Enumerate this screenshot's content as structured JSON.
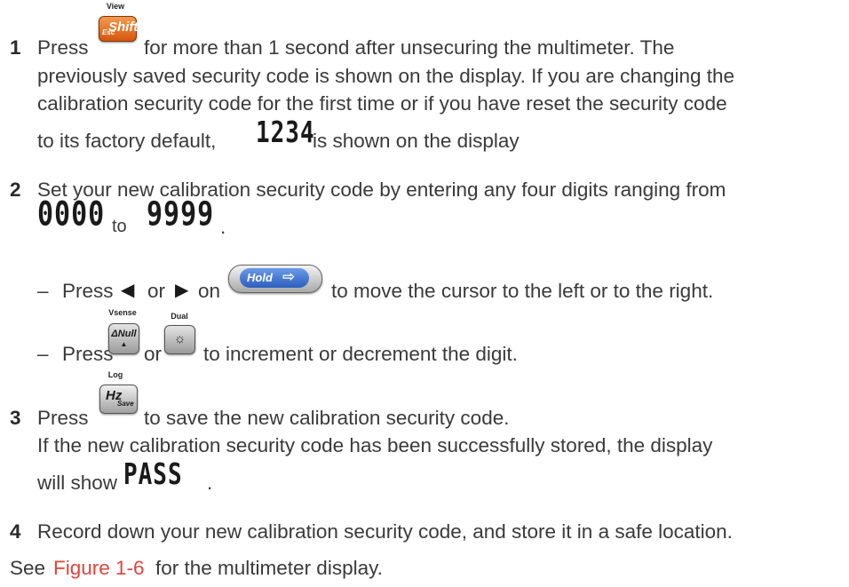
{
  "steps": [
    {
      "number": "1",
      "line1_a": "Press",
      "line1_b": "for more than 1 second after unsecuring the multimeter. The",
      "line2": "previously saved security code is shown on the display. If you are changing the",
      "line3": "calibration security code for the first time or if you have reset the security code",
      "line4_a": "to its factory default,",
      "line4_display": "1234",
      "line4_b": "is shown on the display"
    },
    {
      "number": "2",
      "line1": "Set your new calibration security code by entering any four digits ranging from",
      "range_from": "0000",
      "range_to_word": "to",
      "range_to": "9999",
      "range_end": "."
    },
    {
      "number": "3",
      "line1_a": "Press",
      "line1_b": "to save the new calibration security code.",
      "line2": "If the new calibration security code has been successfully stored, the display",
      "line3_a": "will show",
      "line3_display": "PASS",
      "line3_end": "."
    },
    {
      "number": "4",
      "line1": "Record down your new calibration security code, and store it in a safe location."
    }
  ],
  "sub_bullets": [
    {
      "dash": "–",
      "press": "Press",
      "left_arrow": "◀",
      "or": "or",
      "right_arrow": "▶",
      "on": "on",
      "text": "to move the cursor to the left or to the right."
    },
    {
      "dash": "–",
      "press": "Press",
      "or": "or",
      "text": "to increment or decrement the digit."
    }
  ],
  "keys": {
    "shift": {
      "top_label": "View",
      "main": "Shift",
      "sub": "Esc"
    },
    "hold": {
      "main": "Hold",
      "glyph": "⇨"
    },
    "null": {
      "top_label": "Vsense",
      "main": "ΔNull",
      "glyph": "▲"
    },
    "dual": {
      "top_label": "Dual",
      "glyph": "☼"
    },
    "hz": {
      "top_label": "Log",
      "main": "Hz",
      "sub": "Save"
    }
  },
  "footer": {
    "see": "See",
    "link": "Figure 1-6",
    "rest": "for the multimeter display."
  },
  "colors": {
    "link": "#e0443c",
    "shift_key": "#e86a1e",
    "hold_key": "#3b6fc9",
    "text": "#3a3a3a"
  }
}
